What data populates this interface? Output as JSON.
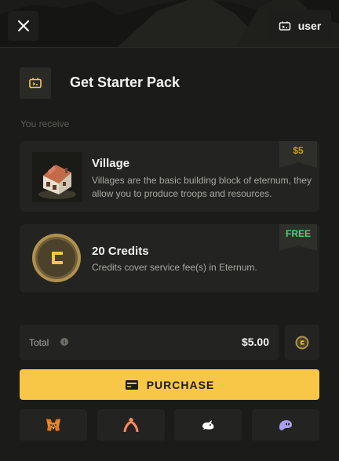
{
  "header": {
    "user_label": "user"
  },
  "dialog": {
    "title": "Get Starter Pack",
    "receive_label": "You receive"
  },
  "items": [
    {
      "title": "Village",
      "description": "Villages are the basic building block of eternum, they allow you to produce troops and resources.",
      "badge": "$5"
    },
    {
      "title": "20 Credits",
      "description": "Credits cover service fee(s) in Eternum.",
      "badge": "FREE"
    }
  ],
  "summary": {
    "total_label": "Total",
    "total_value": "$5.00"
  },
  "actions": {
    "purchase_label": "PURCHASE"
  },
  "wallet_icons": [
    "metamask-icon",
    "argent-icon",
    "rabby-icon",
    "phantom-icon"
  ],
  "colors": {
    "background": "#1b1c19",
    "card": "#232421",
    "accent": "#f8c748",
    "price": "#c79b2a",
    "free": "#4fd06b"
  }
}
